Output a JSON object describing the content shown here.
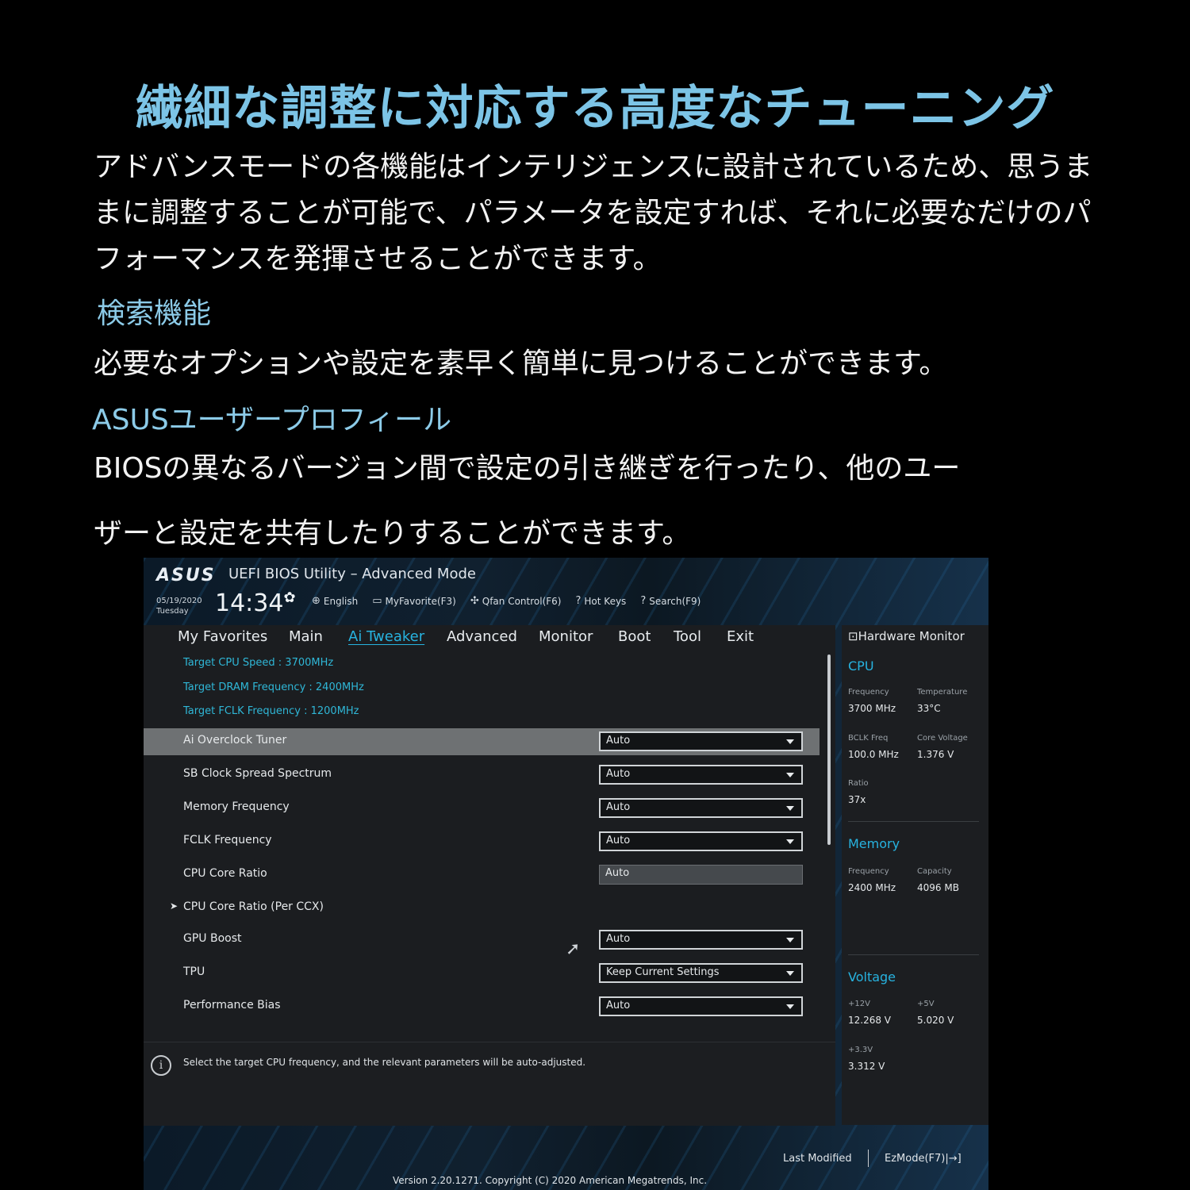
{
  "page": {
    "headline": "繊細な調整に対応する高度なチューニング",
    "intro": "アドバンスモードの各機能はインテリジェンスに設計されているため、思うままに調整することが可能で、パラメータを設定すれば、それに必要なだけのパフォーマンスを発揮させることができます。",
    "search_title": "検索機能",
    "search_desc": "必要なオプションや設定を素早く簡単に見つけることができます。",
    "profile_title": "ASUSユーザープロフィール",
    "profile_desc_1": "BIOSの異なるバージョン間で設定の引き継ぎを行ったり、他のユー",
    "profile_desc_2": "ザーと設定を共有したりすることができます。"
  },
  "bios": {
    "logo": "ASUS",
    "title": "UEFI BIOS Utility – Advanced Mode",
    "date": "05/19/2020",
    "day": "Tuesday",
    "time": "14:34",
    "toolbar": [
      {
        "icon": "globe-icon",
        "label": "English"
      },
      {
        "icon": "favorite-icon",
        "label": "MyFavorite(F3)"
      },
      {
        "icon": "fan-icon",
        "label": "Qfan Control(F6)"
      },
      {
        "icon": "hotkeys-icon",
        "label": "Hot Keys"
      },
      {
        "icon": "search-icon",
        "label": "Search(F9)"
      }
    ],
    "tabs": [
      "My Favorites",
      "Main",
      "Ai Tweaker",
      "Advanced",
      "Monitor",
      "Boot",
      "Tool",
      "Exit"
    ],
    "active_tab": "Ai Tweaker",
    "targets": [
      "Target CPU Speed : 3700MHz",
      "Target DRAM Frequency : 2400MHz",
      "Target FCLK Frequency : 1200MHz"
    ],
    "settings": [
      {
        "label": "Ai Overclock Tuner",
        "value": "Auto"
      },
      {
        "label": "SB Clock Spread Spectrum",
        "value": "Auto"
      },
      {
        "label": "Memory Frequency",
        "value": "Auto"
      },
      {
        "label": "FCLK Frequency",
        "value": "Auto"
      },
      {
        "label": "CPU Core Ratio",
        "value": "Auto"
      },
      {
        "label": "CPU Core Ratio (Per CCX)",
        "value": ""
      },
      {
        "label": "GPU Boost",
        "value": "Auto"
      },
      {
        "label": "TPU",
        "value": "Keep Current Settings"
      },
      {
        "label": "Performance Bias",
        "value": "Auto"
      }
    ],
    "help_text": "Select the target CPU frequency, and the relevant parameters will be auto-adjusted.",
    "hw": {
      "title": "Hardware Monitor",
      "cpu": {
        "title": "CPU",
        "freq_k": "Frequency",
        "freq_v": "3700 MHz",
        "temp_k": "Temperature",
        "temp_v": "33°C",
        "bclk_k": "BCLK Freq",
        "bclk_v": "100.0 MHz",
        "cv_k": "Core Voltage",
        "cv_v": "1.376 V",
        "ratio_k": "Ratio",
        "ratio_v": "37x"
      },
      "memory": {
        "title": "Memory",
        "freq_k": "Frequency",
        "freq_v": "2400 MHz",
        "cap_k": "Capacity",
        "cap_v": "4096 MB"
      },
      "voltage": {
        "title": "Voltage",
        "v12_k": "+12V",
        "v12_v": "12.268 V",
        "v5_k": "+5V",
        "v5_v": "5.020 V",
        "v33_k": "+3.3V",
        "v33_v": "3.312 V"
      }
    },
    "footer": {
      "last_modified": "Last Modified",
      "ezmode": "EzMode(F7)|→]",
      "version": "Version 2.20.1271. Copyright (C) 2020 American Megatrends, Inc."
    }
  }
}
